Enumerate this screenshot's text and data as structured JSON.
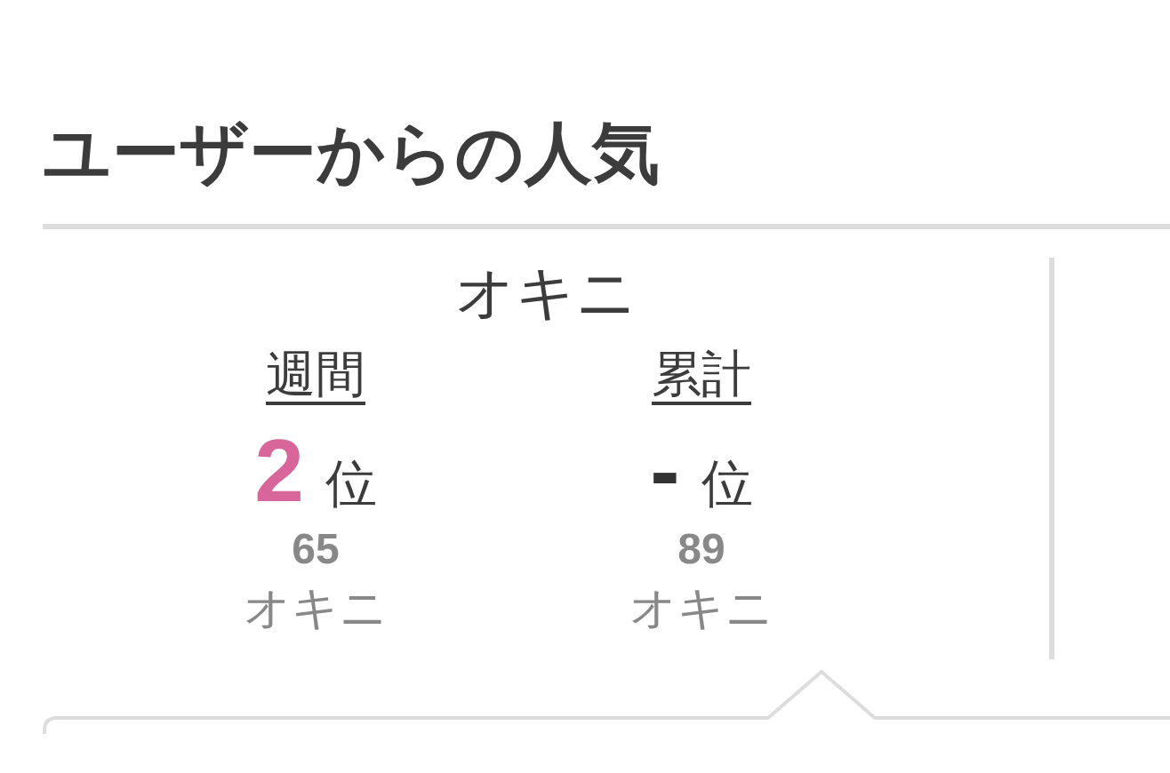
{
  "section_title": "ユーザーからの人気",
  "panel": {
    "heading": "オキニ",
    "columns": [
      {
        "period": "週間",
        "rank": "2",
        "rank_suffix": "位",
        "color": "#d9669b",
        "count": "65",
        "unit": "オキニ"
      },
      {
        "period": "累計",
        "rank": "-",
        "rank_suffix": "位",
        "color": "#333333",
        "count": "89",
        "unit": "オキニ"
      }
    ]
  }
}
